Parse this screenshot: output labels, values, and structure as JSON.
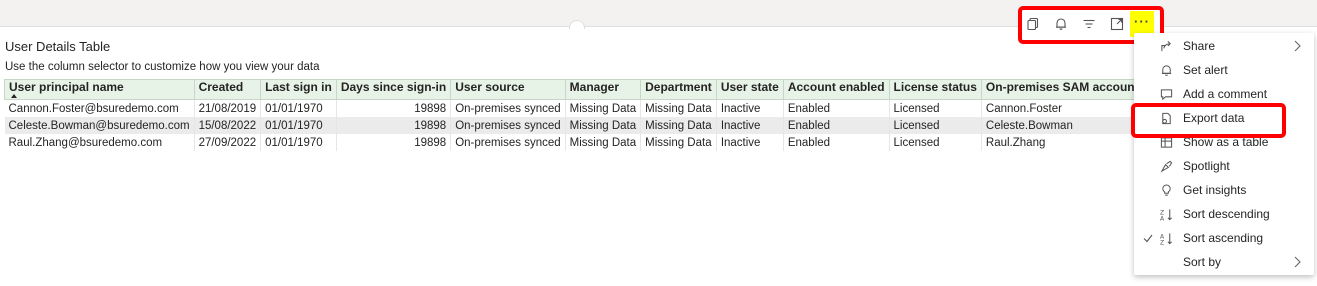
{
  "visual": {
    "title": "User Details Table",
    "subtitle": "Use the column selector to customize how you view your data"
  },
  "header_icons": [
    "copy-icon",
    "bell-icon",
    "filter-icon",
    "focus-mode-icon",
    "more-options-icon"
  ],
  "more_label": "···",
  "table": {
    "columns": [
      "User principal name",
      "Created",
      "Last sign in",
      "Days since sign-in",
      "User source",
      "Manager",
      "Department",
      "User state",
      "Account enabled",
      "License status",
      "On-premises SAM account name"
    ],
    "rows": [
      [
        "Cannon.Foster@bsuredemo.com",
        "21/08/2019",
        "01/01/1970",
        "19898",
        "On-premises synced",
        "Missing Data",
        "Missing Data",
        "Inactive",
        "Enabled",
        "Licensed",
        "Cannon.Foster"
      ],
      [
        "Celeste.Bowman@bsuredemo.com",
        "15/08/2022",
        "01/01/1970",
        "19898",
        "On-premises synced",
        "Missing Data",
        "Missing Data",
        "Inactive",
        "Enabled",
        "Licensed",
        "Celeste.Bowman"
      ],
      [
        "Raul.Zhang@bsuredemo.com",
        "27/09/2022",
        "01/01/1970",
        "19898",
        "On-premises synced",
        "Missing Data",
        "Missing Data",
        "Inactive",
        "Enabled",
        "Licensed",
        "Raul.Zhang"
      ]
    ]
  },
  "context_menu": {
    "items": [
      {
        "label": "Share",
        "icon": "share-icon",
        "submenu": true
      },
      {
        "label": "Set alert",
        "icon": "bell-icon"
      },
      {
        "label": "Add a comment",
        "icon": "comment-icon"
      },
      {
        "label": "Export data",
        "icon": "export-icon",
        "highlighted": true
      },
      {
        "label": "Show as a table",
        "icon": "table-icon"
      },
      {
        "label": "Spotlight",
        "icon": "spotlight-icon"
      },
      {
        "label": "Get insights",
        "icon": "lightbulb-icon"
      },
      {
        "label": "Sort descending",
        "icon": "sort-descending-icon"
      },
      {
        "label": "Sort ascending",
        "icon": "sort-ascending-icon",
        "checked": true
      },
      {
        "label": "Sort by",
        "icon": "",
        "submenu": true
      }
    ]
  },
  "colors": {
    "highlight_border": "#ff0000",
    "more_button_bg": "#ffff00",
    "header_bg": "#e8f3e8",
    "alt_row_bg": "#ebebeb"
  }
}
